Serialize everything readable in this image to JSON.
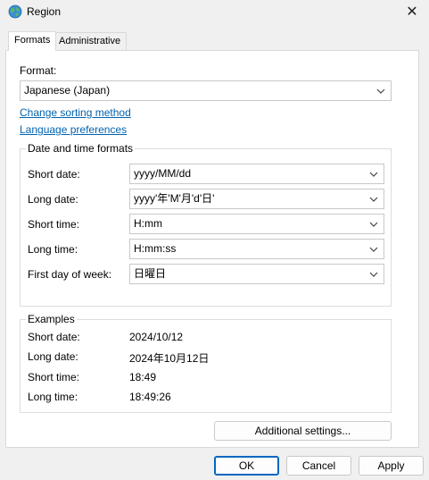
{
  "window": {
    "title": "Region",
    "close_glyph": "✕"
  },
  "tabs": [
    {
      "label": "Formats",
      "active": true
    },
    {
      "label": "Administrative",
      "active": false
    }
  ],
  "format": {
    "label": "Format:",
    "value": "Japanese (Japan)"
  },
  "links": {
    "change_sorting": "Change sorting method",
    "language_prefs": "Language preferences"
  },
  "date_time_group": {
    "title": "Date and time formats",
    "rows": [
      {
        "label": "Short date:",
        "value": "yyyy/MM/dd"
      },
      {
        "label": "Long date:",
        "value": "yyyy'年'M'月'd'日'"
      },
      {
        "label": "Short time:",
        "value": "H:mm"
      },
      {
        "label": "Long time:",
        "value": "H:mm:ss"
      },
      {
        "label": "First day of week:",
        "value": "日曜日"
      }
    ]
  },
  "examples_group": {
    "title": "Examples",
    "rows": [
      {
        "label": "Short date:",
        "value": "2024/10/12"
      },
      {
        "label": "Long date:",
        "value": "2024年10月12日"
      },
      {
        "label": "Short time:",
        "value": "18:49"
      },
      {
        "label": "Long time:",
        "value": "18:49:26"
      }
    ]
  },
  "buttons": {
    "additional": "Additional settings...",
    "ok": "OK",
    "cancel": "Cancel",
    "apply": "Apply"
  },
  "colors": {
    "link": "#0063b1",
    "default_button_border": "#0067c0"
  }
}
